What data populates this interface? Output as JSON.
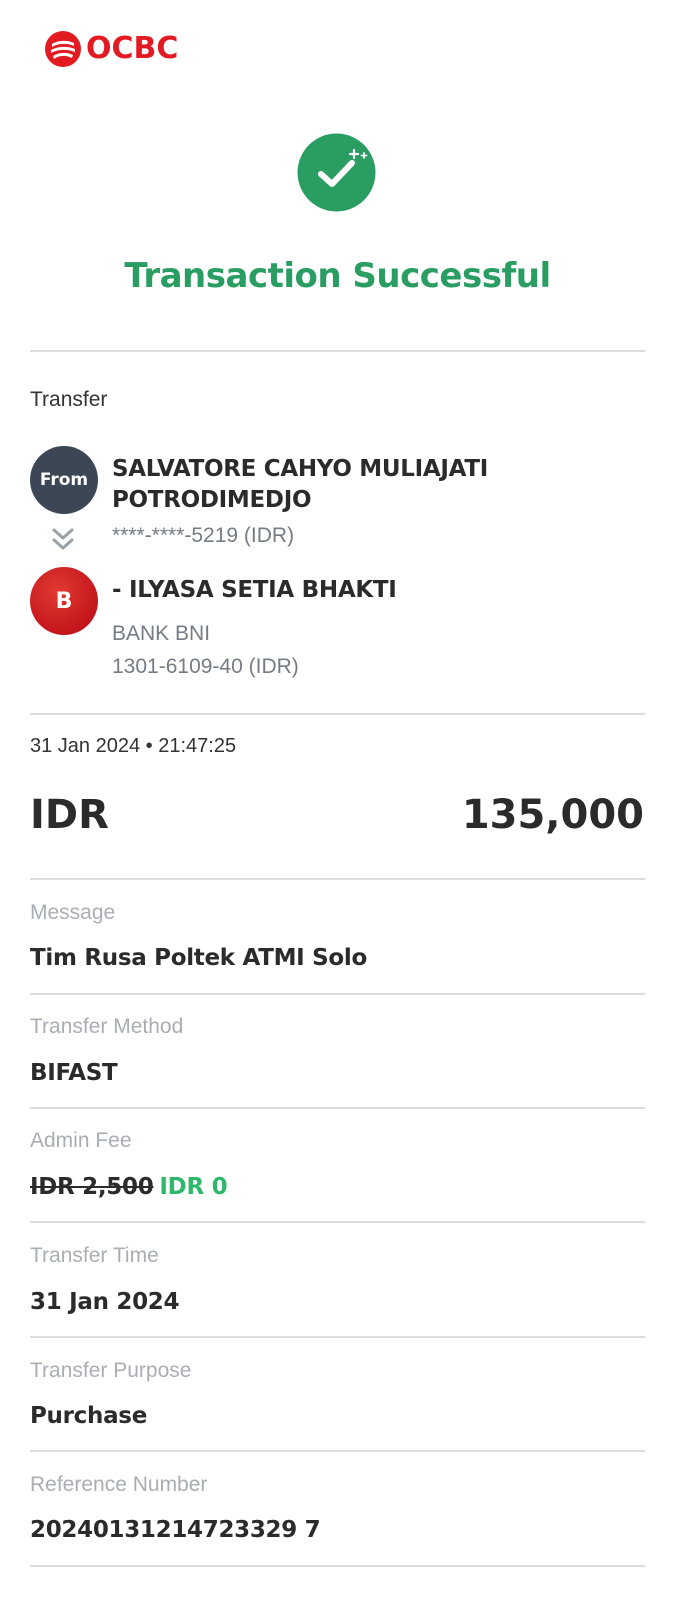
{
  "brand": {
    "name": "OCBC",
    "color": "#e21b23"
  },
  "status": {
    "icon": "check-circle-icon",
    "title": "Transaction Successful",
    "color": "#2a9d63"
  },
  "transfer": {
    "section_label": "Transfer",
    "from": {
      "avatar_label": "From",
      "name": "SALVATORE CAHYO MULIAJATI POTRODIMEDJO",
      "account": "****-****-5219 (IDR)"
    },
    "to": {
      "avatar_label": "B",
      "name": "- ILYASA SETIA BHAKTI",
      "bank": "BANK BNI",
      "account": "1301-6109-40 (IDR)"
    }
  },
  "summary": {
    "datetime": "31 Jan 2024 • 21:47:25",
    "currency": "IDR",
    "amount": "135,000"
  },
  "details": {
    "message_label": "Message",
    "message_value": "Tim Rusa Poltek ATMI Solo",
    "method_label": "Transfer Method",
    "method_value": "BIFAST",
    "fee_label": "Admin Fee",
    "fee_original": "IDR 2,500",
    "fee_final": "IDR 0",
    "time_label": "Transfer Time",
    "time_value": "31 Jan 2024",
    "purpose_label": "Transfer Purpose",
    "purpose_value": "Purchase",
    "reference_label": "Reference Number",
    "reference_value": "20240131214723329 7"
  }
}
